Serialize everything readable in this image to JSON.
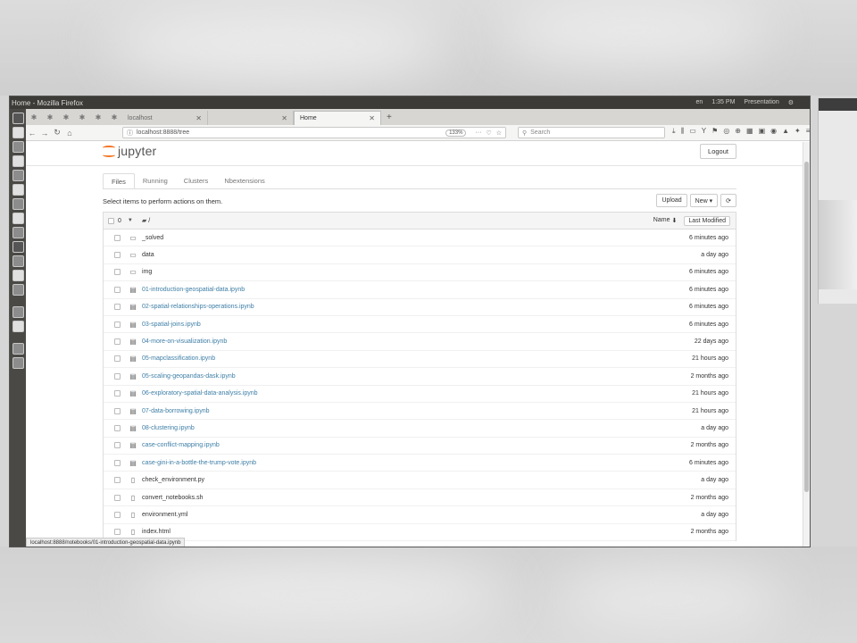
{
  "os": {
    "window_title": "Home - Mozilla Firefox",
    "indicators": [
      "",
      "en",
      "",
      "1:35 PM",
      "Presentation"
    ]
  },
  "browser": {
    "tabs": [
      {
        "label": "localhost",
        "active": false
      },
      {
        "label": "",
        "active": false
      },
      {
        "label": "Home",
        "active": true
      }
    ],
    "url": "localhost:8888/tree",
    "zoom": "133%",
    "search_placeholder": "Search",
    "status_url": "localhost:8888/notebooks/01-introduction-geospatial-data.ipynb"
  },
  "jupyter": {
    "logo_text": "jupyter",
    "logout_label": "Logout",
    "nav_tabs": [
      "Files",
      "Running",
      "Clusters",
      "Nbextensions"
    ],
    "select_text": "Select items to perform actions on them.",
    "upload_label": "Upload",
    "new_label": "New ▾",
    "refresh_icon": "⟳",
    "header": {
      "count": "0",
      "path": "/",
      "name_label": "Name",
      "sort_icon": "⬇",
      "last_modified_label": "Last Modified"
    },
    "files": [
      {
        "name": "_solved",
        "type": "folder",
        "modified": "6 minutes ago"
      },
      {
        "name": "data",
        "type": "folder",
        "modified": "a day ago"
      },
      {
        "name": "img",
        "type": "folder",
        "modified": "6 minutes ago"
      },
      {
        "name": "01-introduction-geospatial-data.ipynb",
        "type": "notebook",
        "modified": "6 minutes ago"
      },
      {
        "name": "02-spatial-relationships-operations.ipynb",
        "type": "notebook",
        "modified": "6 minutes ago"
      },
      {
        "name": "03-spatial-joins.ipynb",
        "type": "notebook",
        "modified": "6 minutes ago"
      },
      {
        "name": "04-more-on-visualization.ipynb",
        "type": "notebook",
        "modified": "22 days ago"
      },
      {
        "name": "05-mapclassification.ipynb",
        "type": "notebook",
        "modified": "21 hours ago"
      },
      {
        "name": "05-scaling-geopandas-dask.ipynb",
        "type": "notebook",
        "modified": "2 months ago"
      },
      {
        "name": "06-exploratory-spatial-data-analysis.ipynb",
        "type": "notebook",
        "modified": "21 hours ago"
      },
      {
        "name": "07-data-borrowing.ipynb",
        "type": "notebook",
        "modified": "21 hours ago"
      },
      {
        "name": "08-clustering.ipynb",
        "type": "notebook",
        "modified": "a day ago"
      },
      {
        "name": "case-conflict-mapping.ipynb",
        "type": "notebook",
        "modified": "2 months ago"
      },
      {
        "name": "case-gini-in-a-bottle-the-trump-vote.ipynb",
        "type": "notebook",
        "modified": "6 minutes ago"
      },
      {
        "name": "check_environment.py",
        "type": "file",
        "modified": "a day ago"
      },
      {
        "name": "convert_notebooks.sh",
        "type": "file",
        "modified": "2 months ago"
      },
      {
        "name": "environment.yml",
        "type": "file",
        "modified": "a day ago"
      },
      {
        "name": "index.html",
        "type": "file",
        "modified": "2 months ago"
      }
    ]
  },
  "icons": {
    "folder": "folder-icon",
    "notebook": "notebook-icon",
    "file": "file-icon"
  }
}
